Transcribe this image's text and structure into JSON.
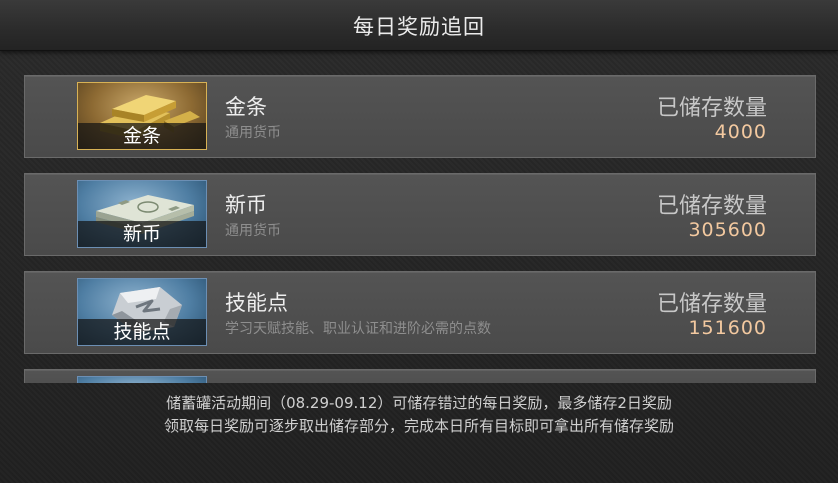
{
  "header": {
    "title": "每日奖励追回"
  },
  "items": [
    {
      "icon": "gold-bar-icon",
      "thumb_label": "金条",
      "name": "金条",
      "description": "通用货币",
      "stored_label": "已储存数量",
      "stored_value": "4000"
    },
    {
      "icon": "banknote-stack-icon",
      "thumb_label": "新币",
      "name": "新币",
      "description": "通用货币",
      "stored_label": "已储存数量",
      "stored_value": "305600"
    },
    {
      "icon": "skill-point-stone-icon",
      "thumb_label": "技能点",
      "name": "技能点",
      "description": "学习天赋技能、职业认证和进阶必需的点数",
      "stored_label": "已储存数量",
      "stored_value": "151600"
    }
  ],
  "footer": {
    "line1": "储蓄罐活动期间（08.29-09.12）可储存错过的每日奖励，最多储存2日奖励",
    "line2": "领取每日奖励可逐步取出储存部分，完成本日所有目标即可拿出所有储存奖励"
  },
  "colors": {
    "value_accent": "#f3c9a0",
    "gold_frame": "#d8b255",
    "blue_frame": "#6c8fb4"
  }
}
